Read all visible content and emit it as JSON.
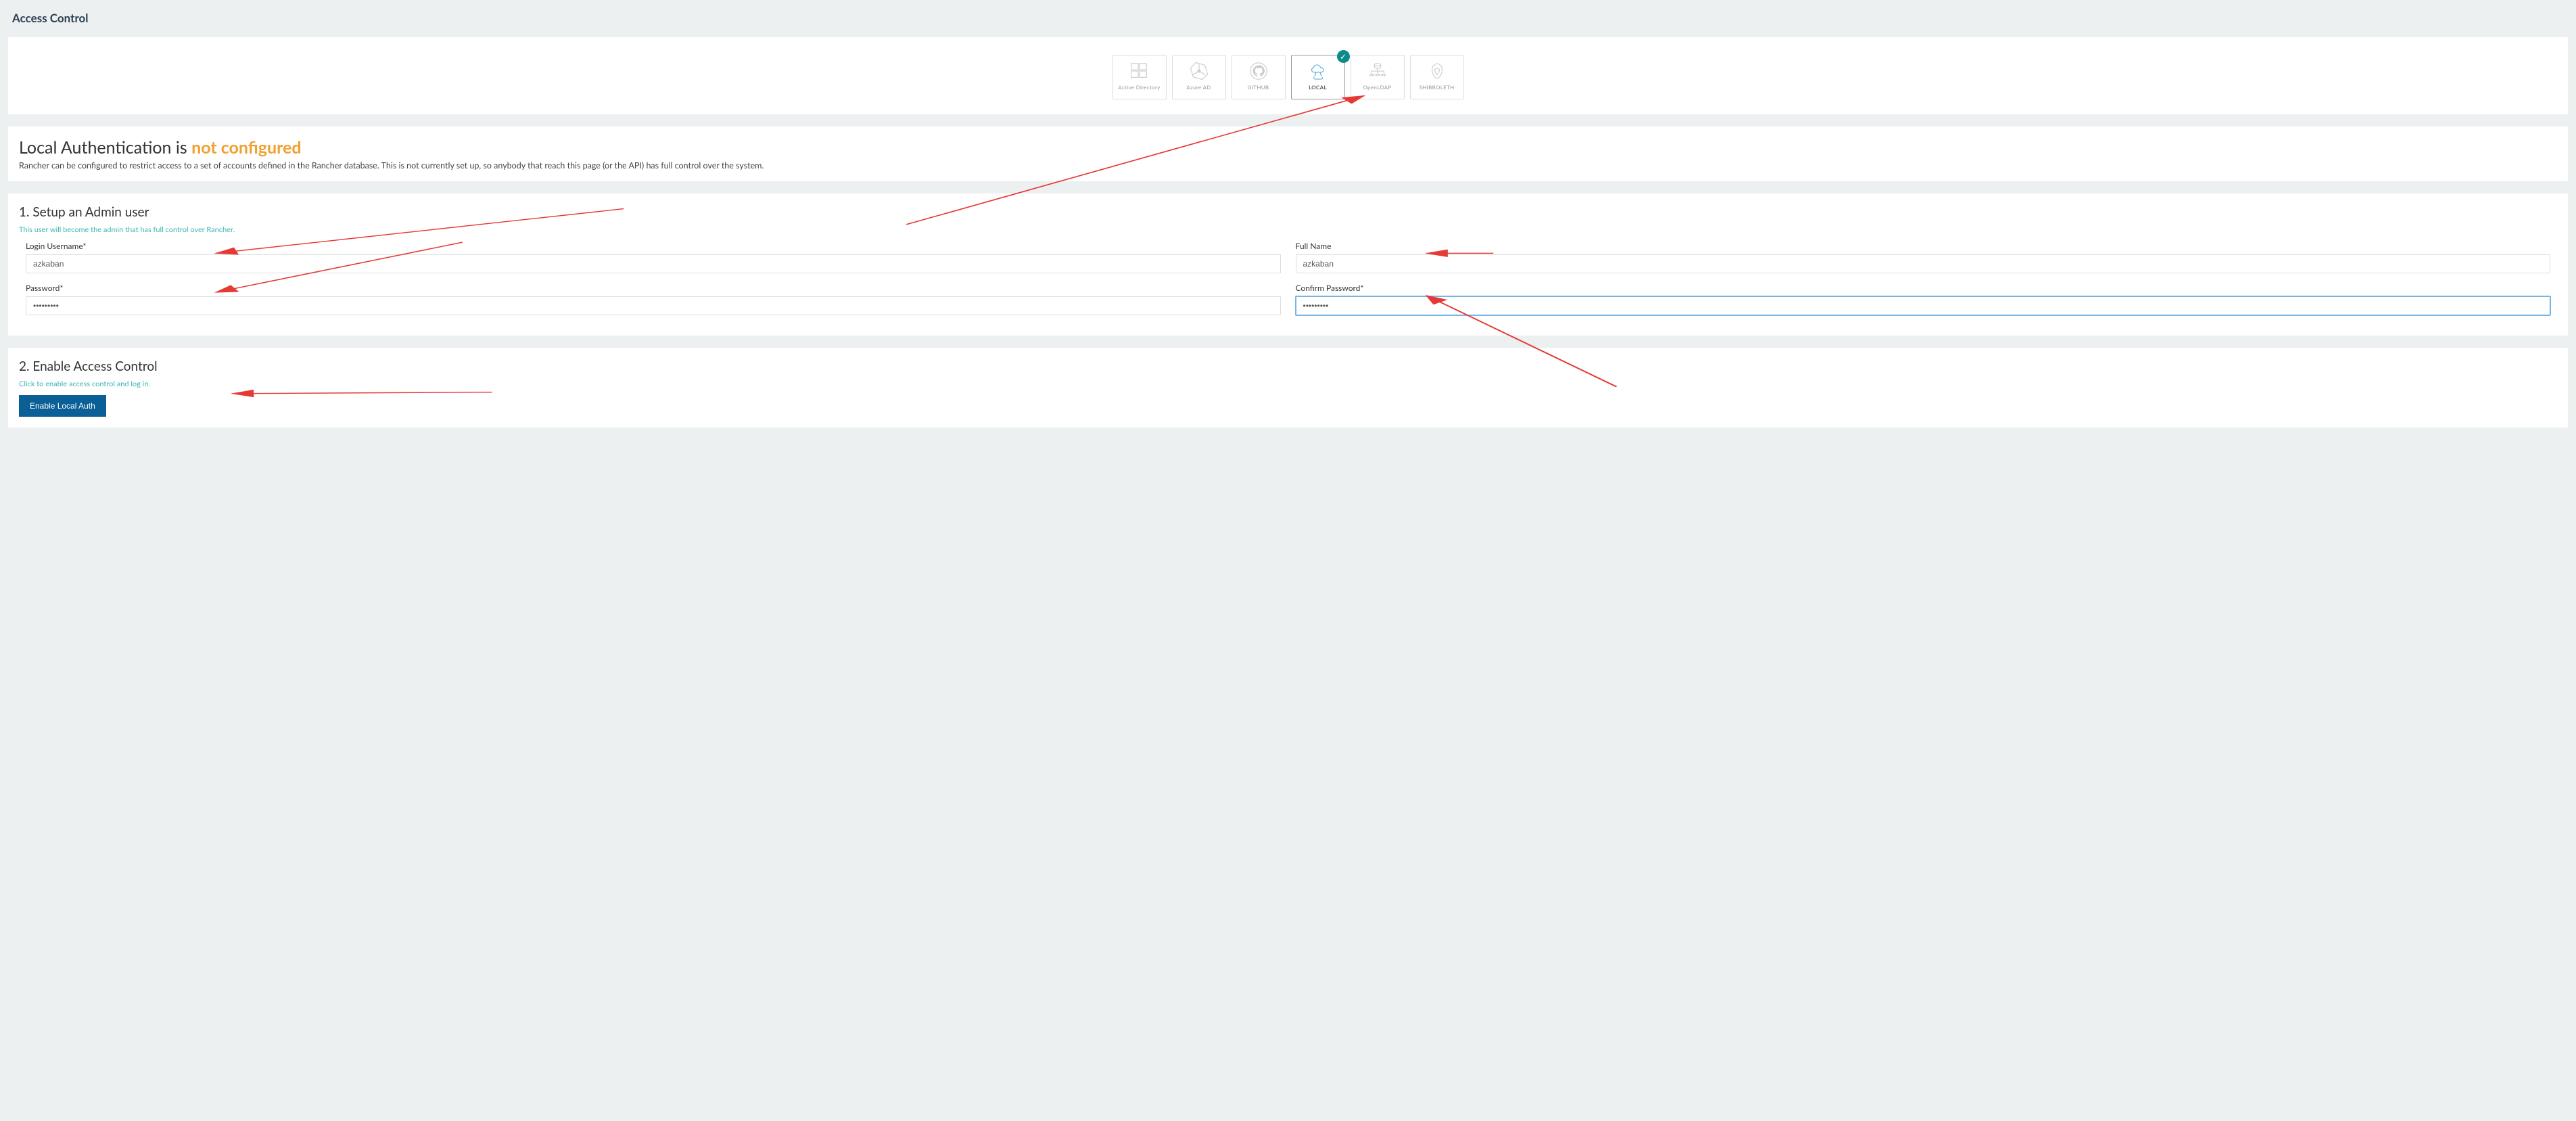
{
  "pageTitle": "Access Control",
  "auth": {
    "tiles": [
      {
        "label": "Active Directory"
      },
      {
        "label": "Azure AD"
      },
      {
        "label": "GITHUB"
      },
      {
        "label": "LOCAL"
      },
      {
        "label": "OpenLDAP"
      },
      {
        "label": "SHIBBOLETH"
      }
    ]
  },
  "status": {
    "prefix": "Local Authentication is ",
    "highlight": "not configured",
    "desc": "Rancher can be configured to restrict access to a set of accounts defined in the Rancher database. This is not currently set up, so anybody that reach this page (or the API) has full control over the system."
  },
  "step1": {
    "title": "1. Setup an Admin user",
    "hint": "This user will become the admin that has full control over Rancher.",
    "usernameLabel": "Login Username*",
    "usernameValue": "azkaban",
    "fullnameLabel": "Full Name",
    "fullnameValue": "azkaban",
    "passwordLabel": "Password*",
    "passwordValue": "•••••••••",
    "confirmLabel": "Confirm Password*",
    "confirmValue": "•••••••••"
  },
  "step2": {
    "title": "2. Enable Access Control",
    "hint": "Click to enable access control and log in.",
    "button": "Enable Local Auth"
  }
}
